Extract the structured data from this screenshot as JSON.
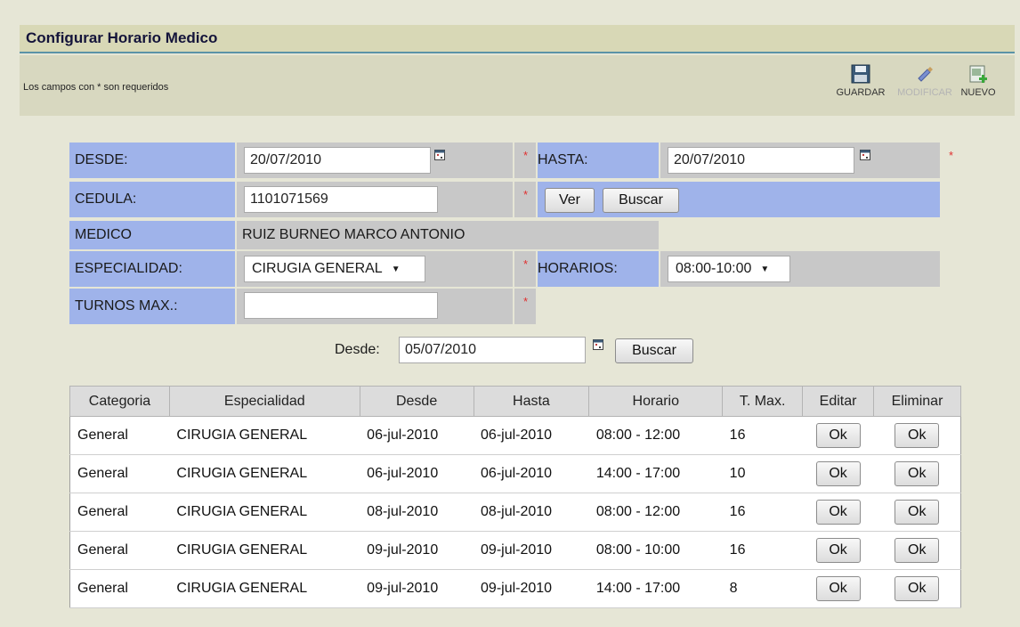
{
  "header": {
    "title": "Configurar Horario Medico",
    "required_note": "Los campos con * son requeridos"
  },
  "toolbar": {
    "guardar": "GUARDAR",
    "modificar": "MODIFICAR",
    "nuevo": "NUEVO",
    "icons": {
      "guardar": "save-disk-icon",
      "modificar": "edit-brush-icon",
      "nuevo": "new-document-icon"
    }
  },
  "form": {
    "desde_label": "DESDE:",
    "desde_value": "20/07/2010",
    "hasta_label": "HASTA:",
    "hasta_value": "20/07/2010",
    "cedula_label": "CEDULA:",
    "cedula_value": "1101071569",
    "ver_button": "Ver",
    "buscar_button": "Buscar",
    "medico_label": "MEDICO",
    "medico_value": "RUIZ BURNEO MARCO ANTONIO",
    "especialidad_label": "ESPECIALIDAD:",
    "especialidad_value": "CIRUGIA GENERAL",
    "horarios_label": "HORARIOS:",
    "horarios_value": "08:00-10:00",
    "turnos_label": "TURNOS MAX.:",
    "turnos_value": "",
    "required_mark": "*"
  },
  "filter": {
    "label": "Desde:",
    "value": "05/07/2010",
    "buscar_button": "Buscar"
  },
  "table": {
    "headers": [
      "Categoria",
      "Especialidad",
      "Desde",
      "Hasta",
      "Horario",
      "T. Max.",
      "Editar",
      "Eliminar"
    ],
    "ok_label": "Ok",
    "rows": [
      [
        "General",
        "CIRUGIA GENERAL",
        "06-jul-2010",
        "06-jul-2010",
        "08:00 - 12:00",
        "16"
      ],
      [
        "General",
        "CIRUGIA GENERAL",
        "06-jul-2010",
        "06-jul-2010",
        "14:00 - 17:00",
        "10"
      ],
      [
        "General",
        "CIRUGIA GENERAL",
        "08-jul-2010",
        "08-jul-2010",
        "08:00 - 12:00",
        "16"
      ],
      [
        "General",
        "CIRUGIA GENERAL",
        "09-jul-2010",
        "09-jul-2010",
        "08:00 - 10:00",
        "16"
      ],
      [
        "General",
        "CIRUGIA GENERAL",
        "09-jul-2010",
        "09-jul-2010",
        "14:00 - 17:00",
        "8"
      ]
    ]
  },
  "colors": {
    "label_blue": "#9fb3ea",
    "field_gray": "#c8c8c8",
    "title_bar": "#d8d8b6",
    "required_red": "#e03030"
  }
}
